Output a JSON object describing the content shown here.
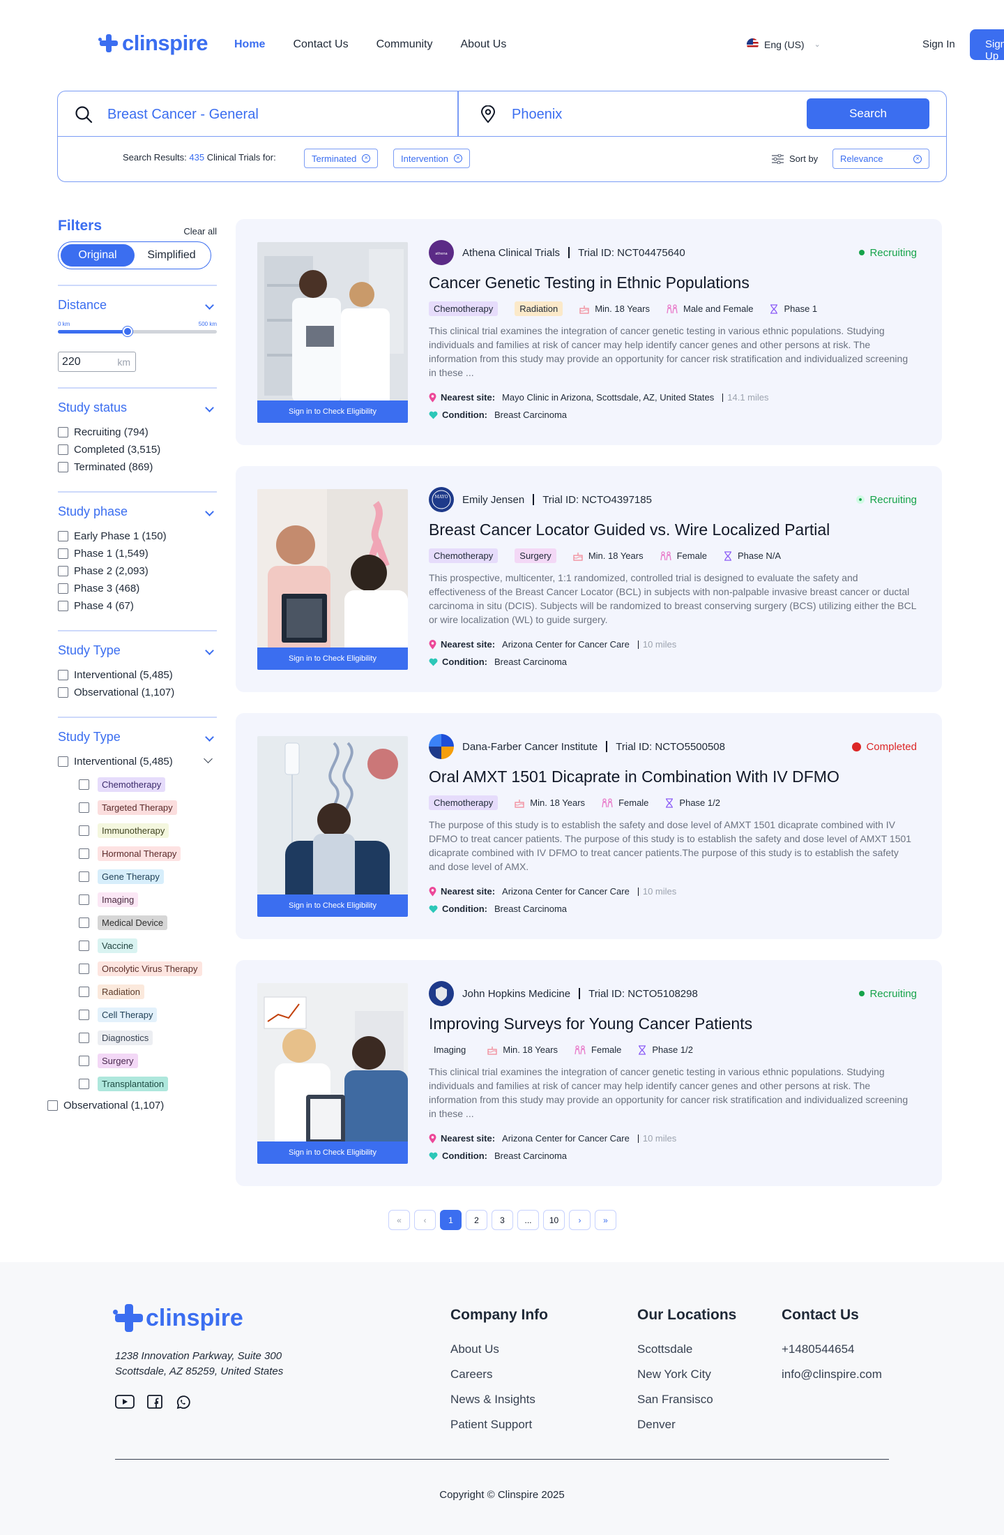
{
  "brand": {
    "name": "clinspire"
  },
  "nav": {
    "home": "Home",
    "contact": "Contact Us",
    "community": "Community",
    "about": "About Us"
  },
  "header": {
    "language": "Eng (US)",
    "sign_in": "Sign In",
    "sign_up": "Sign Up"
  },
  "search": {
    "condition": "Breast Cancer - General",
    "location": "Phoenix",
    "button": "Search",
    "results_prefix": "Search Results:",
    "results_count": "435",
    "results_suffix": "Clinical Trials for:",
    "chips": [
      "Terminated",
      "Intervention"
    ],
    "sort_label": "Sort by",
    "sort_value": "Relevance"
  },
  "filters": {
    "title": "Filters",
    "clear_all": "Clear all",
    "toggle": [
      "Original",
      "Simplified"
    ],
    "distance": {
      "title": "Distance",
      "min_label": "0 km",
      "max_label": "500 km",
      "value": "220",
      "unit": "km",
      "fraction": 0.44
    },
    "study_status": {
      "title": "Study status",
      "items": [
        "Recruiting (794)",
        "Completed (3,515)",
        "Terminated (869)"
      ]
    },
    "study_phase": {
      "title": "Study phase",
      "items": [
        "Early Phase 1 (150)",
        "Phase 1 (1,549)",
        "Phase 2 (2,093)",
        "Phase 3 (468)",
        "Phase 4 (67)"
      ]
    },
    "study_type": {
      "title": "Study Type",
      "items": [
        "Interventional (5,485)",
        "Observational (1,107)"
      ]
    },
    "study_type_2": {
      "title": "Study Type",
      "interventional": "Interventional (5,485)",
      "tags": [
        {
          "label": "Chemotherapy",
          "bg": "#e6dcfb",
          "fg": "#3b2a6b"
        },
        {
          "label": "Targeted Therapy",
          "bg": "#fbdede",
          "fg": "#5b2a2a"
        },
        {
          "label": "Immunotherapy",
          "bg": "#f4f7de",
          "fg": "#3f4320"
        },
        {
          "label": "Hormonal Therapy",
          "bg": "#fde2e2",
          "fg": "#5b2a2a"
        },
        {
          "label": "Gene Therapy",
          "bg": "#d7eefb",
          "fg": "#1f3f55"
        },
        {
          "label": "Imaging",
          "bg": "#fbe7f5",
          "fg": "#4a2a40"
        },
        {
          "label": "Medical Device",
          "bg": "#d6d6d6",
          "fg": "#2f2f2f"
        },
        {
          "label": "Vaccine",
          "bg": "#d9f3f1",
          "fg": "#21433f"
        },
        {
          "label": "Oncolytic Virus Therapy",
          "bg": "#fde5e0",
          "fg": "#5b2f2a"
        },
        {
          "label": "Radiation",
          "bg": "#fbe9dc",
          "fg": "#5b3a2a"
        },
        {
          "label": "Cell Therapy",
          "bg": "#e3f1fb",
          "fg": "#1f3f55"
        },
        {
          "label": "Diagnostics",
          "bg": "#eceef2",
          "fg": "#374151"
        },
        {
          "label": "Surgery",
          "bg": "#f3d8f6",
          "fg": "#4a2a50"
        },
        {
          "label": "Transplantation",
          "bg": "#aee7dc",
          "fg": "#1d4a42"
        }
      ],
      "observational": "Observational (1,107)"
    }
  },
  "trials": [
    {
      "org": "Athena Clinical Trials",
      "trial_id": "Trial ID: NCT04475640",
      "status": "Recruiting",
      "status_color": "#16a34a",
      "title": "Cancer Genetic Testing in Ethnic Populations",
      "tags": [
        {
          "label": "Chemotherapy",
          "bg": "#e6dcfb"
        },
        {
          "label": "Radiation",
          "bg": "#fbe9c9"
        }
      ],
      "age": "Min. 18 Years",
      "gender": "Male and Female",
      "phase": "Phase 1",
      "desc": "This clinical trial examines the integration of cancer genetic testing in various ethnic populations. Studying individuals and families at risk of cancer may help identify cancer genes and other persons at risk. The information from this study may provide an opportunity for cancer risk stratification and individualized screening in these ...",
      "site_label": "Nearest site:",
      "site": "Mayo Clinic in Arizona, Scottsdale, AZ, United States",
      "miles": "14.1 miles",
      "cond_label": "Condition:",
      "condition": "Breast Carcinoma",
      "cta": "Sign in to Check Eligibility",
      "logo_color": "#5b2a86"
    },
    {
      "org": "Emily Jensen",
      "trial_id": "Trial ID: NCTO4397185",
      "status": "Recruiting",
      "status_color": "#16a34a",
      "title": "Breast Cancer Locator Guided vs. Wire Localized Partial",
      "tags": [
        {
          "label": "Chemotherapy",
          "bg": "#e6dcfb"
        },
        {
          "label": "Surgery",
          "bg": "#f3d8f6"
        }
      ],
      "age": "Min. 18 Years",
      "gender": "Female",
      "phase": "Phase N/A",
      "desc": "This prospective, multicenter, 1:1 randomized, controlled trial is designed to evaluate the safety and effectiveness of the Breast Cancer Locator (BCL) in subjects with non-palpable invasive breast cancer or ductal carcinoma in situ (DCIS). Subjects will be randomized to breast conserving surgery (BCS) utilizing either the BCL or wire localization (WL) to guide surgery.",
      "site_label": "Nearest site:",
      "site": "Arizona Center for Cancer Care",
      "miles": "10 miles",
      "cond_label": "Condition:",
      "condition": "Breast Carcinoma",
      "cta": "Sign in to Check Eligibility",
      "logo_color": "#1e3a8a"
    },
    {
      "org": "Dana-Farber Cancer Institute",
      "trial_id": "Trial ID: NCTO5500508",
      "status": "Completed",
      "status_color": "#dc2626",
      "title": "Oral AMXT 1501 Dicaprate in Combination With IV DFMO",
      "tags": [
        {
          "label": "Chemotherapy",
          "bg": "#e6dcfb"
        }
      ],
      "age": "Min. 18 Years",
      "gender": "Female",
      "phase": "Phase 1/2",
      "desc": "The purpose of this study is to establish the safety and dose level of AMXT 1501 dicaprate combined with IV DFMO to treat cancer patients. The purpose of this study is to establish the safety and dose level of AMXT 1501 dicaprate combined with IV DFMO to treat cancer patients.The purpose of this study is to establish the safety and dose level of AMX.",
      "site_label": "Nearest site:",
      "site": "Arizona Center for Cancer Care",
      "miles": "10 miles",
      "cond_label": "Condition:",
      "condition": "Breast Carcinoma",
      "cta": "Sign in to Check Eligibility",
      "logo_color": "#1d4ed8"
    },
    {
      "org": "John Hopkins Medicine",
      "trial_id": "Trial ID: NCTO5108298",
      "status": "Recruiting",
      "status_color": "#16a34a",
      "title": "Improving Surveys for Young Cancer Patients",
      "tags": [
        {
          "label": "Imaging",
          "bg": "#f3f5fd"
        }
      ],
      "age": "Min. 18 Years",
      "gender": "Female",
      "phase": "Phase 1/2",
      "desc": "This clinical trial examines the integration of cancer genetic testing in various ethnic populations. Studying individuals and families at risk of cancer may help identify cancer genes and other persons at risk. The information from this study may provide an opportunity for cancer risk stratification and individualized screening in these ...",
      "site_label": "Nearest site:",
      "site": "Arizona Center for Cancer Care",
      "miles": "10 miles",
      "cond_label": "Condition:",
      "condition": "Breast Carcinoma",
      "cta": "Sign in to Check Eligibility",
      "logo_color": "#1e3a8a"
    }
  ],
  "pagination": {
    "first": "«",
    "prev": "‹",
    "pages": [
      "1",
      "2",
      "3",
      "...",
      "10"
    ],
    "next": "›",
    "last": "»",
    "current": "1"
  },
  "footer": {
    "address_1": "1238 Innovation Parkway, Suite 300",
    "address_2": "Scottsdale, AZ 85259, United States",
    "company": {
      "title": "Company Info",
      "items": [
        "About Us",
        "Careers",
        "News & Insights",
        "Patient Support"
      ]
    },
    "locations": {
      "title": "Our Locations",
      "items": [
        "Scottsdale",
        "New York City",
        "San Fransisco",
        "Denver"
      ]
    },
    "contact": {
      "title": "Contact Us",
      "items": [
        "+1480544654",
        "info@clinspire.com"
      ]
    },
    "copyright": "Copyright © Clinspire 2025"
  },
  "colors": {
    "accent": "#3b6ef0",
    "card_bg": "#f3f5fd"
  }
}
